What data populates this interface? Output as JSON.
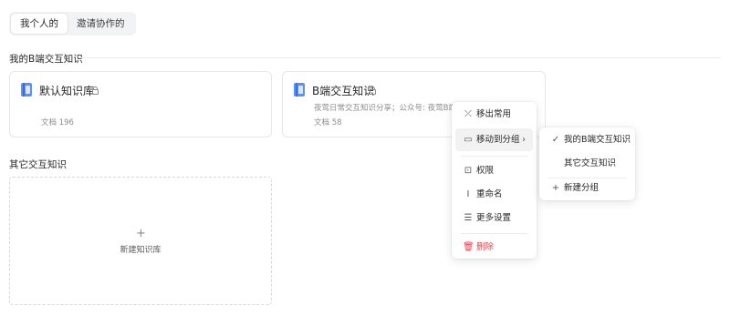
{
  "tabs": {
    "mine": "我个人的",
    "invited": "邀请协作的"
  },
  "sections": {
    "group1": "我的B端交互知识",
    "group2": "其它交互知识"
  },
  "cards": [
    {
      "title": "默认知识库",
      "description": "",
      "meta": "文档 196"
    },
    {
      "title": "B端交互知识",
      "description": "夜莺日常交互知识分享；公众号: 夜莺B端UX",
      "meta": "文档 58"
    }
  ],
  "new_library": {
    "plus": "+",
    "label": "新建知识库"
  },
  "context_menu": {
    "remove_frequent": "移出常用",
    "move_to_group": "移动到分组",
    "permissions": "权限",
    "rename": "重命名",
    "more_settings": "更多设置",
    "delete": "删除"
  },
  "submenu": {
    "group1": "我的B端交互知识",
    "group2": "其它交互知识",
    "new_group": "新建分组",
    "selected": "我的B端交互知识"
  },
  "colors": {
    "accent": "#5b8ff9",
    "danger": "#e0454b"
  }
}
